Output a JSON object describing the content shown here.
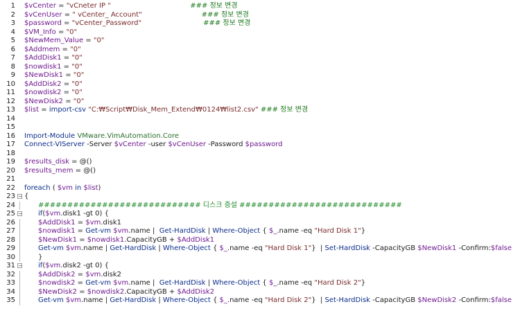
{
  "lines": [
    {
      "n": "1",
      "fold": "",
      "guide": false,
      "indent": 0,
      "tokens": [
        {
          "t": "v",
          "x": "$vCenter"
        },
        {
          "t": "p",
          "x": " = "
        },
        {
          "t": "s",
          "x": "\"vCneter IP \""
        },
        {
          "t": "p",
          "x": "                                    "
        },
        {
          "t": "cm",
          "x": "### 정보 변경"
        }
      ]
    },
    {
      "n": "2",
      "fold": "",
      "guide": false,
      "indent": 0,
      "tokens": [
        {
          "t": "v",
          "x": "$vCenUser"
        },
        {
          "t": "p",
          "x": " = "
        },
        {
          "t": "s",
          "x": "\" vCenter_ Account\""
        },
        {
          "t": "p",
          "x": "                           "
        },
        {
          "t": "cm",
          "x": "### 정보 변경"
        }
      ]
    },
    {
      "n": "3",
      "fold": "",
      "guide": false,
      "indent": 0,
      "tokens": [
        {
          "t": "v",
          "x": "$password"
        },
        {
          "t": "p",
          "x": " = "
        },
        {
          "t": "s",
          "x": "\"vCenter_Password\""
        },
        {
          "t": "p",
          "x": "                            "
        },
        {
          "t": "cm",
          "x": "### 정보 변경"
        }
      ]
    },
    {
      "n": "4",
      "fold": "",
      "guide": false,
      "indent": 0,
      "tokens": [
        {
          "t": "v",
          "x": "$VM_Info"
        },
        {
          "t": "p",
          "x": " = "
        },
        {
          "t": "s",
          "x": "\"0\""
        }
      ]
    },
    {
      "n": "5",
      "fold": "",
      "guide": false,
      "indent": 0,
      "tokens": [
        {
          "t": "v",
          "x": "$NewMem_Value"
        },
        {
          "t": "p",
          "x": " = "
        },
        {
          "t": "s",
          "x": "\"0\""
        }
      ]
    },
    {
      "n": "6",
      "fold": "",
      "guide": false,
      "indent": 0,
      "tokens": [
        {
          "t": "v",
          "x": "$Addmem"
        },
        {
          "t": "p",
          "x": " = "
        },
        {
          "t": "s",
          "x": "\"0\""
        }
      ]
    },
    {
      "n": "7",
      "fold": "",
      "guide": false,
      "indent": 0,
      "tokens": [
        {
          "t": "v",
          "x": "$AddDisk1"
        },
        {
          "t": "p",
          "x": " = "
        },
        {
          "t": "s",
          "x": "\"0\""
        }
      ]
    },
    {
      "n": "8",
      "fold": "",
      "guide": false,
      "indent": 0,
      "tokens": [
        {
          "t": "v",
          "x": "$nowdisk1"
        },
        {
          "t": "p",
          "x": " = "
        },
        {
          "t": "s",
          "x": "\"0\""
        }
      ]
    },
    {
      "n": "9",
      "fold": "",
      "guide": false,
      "indent": 0,
      "tokens": [
        {
          "t": "v",
          "x": "$NewDisk1"
        },
        {
          "t": "p",
          "x": " = "
        },
        {
          "t": "s",
          "x": "\"0\""
        }
      ]
    },
    {
      "n": "10",
      "fold": "",
      "guide": false,
      "indent": 0,
      "tokens": [
        {
          "t": "v",
          "x": "$AddDisk2"
        },
        {
          "t": "p",
          "x": " = "
        },
        {
          "t": "s",
          "x": "\"0\""
        }
      ]
    },
    {
      "n": "11",
      "fold": "",
      "guide": false,
      "indent": 0,
      "tokens": [
        {
          "t": "v",
          "x": "$nowdisk2"
        },
        {
          "t": "p",
          "x": " = "
        },
        {
          "t": "s",
          "x": "\"0\""
        }
      ]
    },
    {
      "n": "12",
      "fold": "",
      "guide": false,
      "indent": 0,
      "tokens": [
        {
          "t": "v",
          "x": "$NewDisk2"
        },
        {
          "t": "p",
          "x": " = "
        },
        {
          "t": "s",
          "x": "\"0\""
        }
      ]
    },
    {
      "n": "13",
      "fold": "",
      "guide": false,
      "indent": 0,
      "tokens": [
        {
          "t": "v",
          "x": "$list"
        },
        {
          "t": "p",
          "x": " = "
        },
        {
          "t": "k",
          "x": "import-csv"
        },
        {
          "t": "p",
          "x": " "
        },
        {
          "t": "s",
          "x": "\"C:₩Script₩Disk_Mem_Extend₩0124₩list2.csv\""
        },
        {
          "t": "p",
          "x": " "
        },
        {
          "t": "cm",
          "x": "### 정보 변경"
        }
      ]
    },
    {
      "n": "14",
      "fold": "",
      "guide": false,
      "indent": 0,
      "tokens": []
    },
    {
      "n": "15",
      "fold": "",
      "guide": false,
      "indent": 0,
      "tokens": []
    },
    {
      "n": "16",
      "fold": "",
      "guide": false,
      "indent": 0,
      "tokens": [
        {
          "t": "k",
          "x": "Import-Module"
        },
        {
          "t": "p",
          "x": " "
        },
        {
          "t": "c",
          "x": "VMware.VimAutomation.Core"
        }
      ]
    },
    {
      "n": "17",
      "fold": "",
      "guide": false,
      "indent": 0,
      "tokens": [
        {
          "t": "k",
          "x": "Connect-VIServer"
        },
        {
          "t": "p",
          "x": " -Server "
        },
        {
          "t": "v",
          "x": "$vCenter"
        },
        {
          "t": "p",
          "x": " -user "
        },
        {
          "t": "v",
          "x": "$vCenUser"
        },
        {
          "t": "p",
          "x": " -Password "
        },
        {
          "t": "v",
          "x": "$password"
        }
      ]
    },
    {
      "n": "18",
      "fold": "",
      "guide": false,
      "indent": 0,
      "tokens": []
    },
    {
      "n": "19",
      "fold": "",
      "guide": false,
      "indent": 0,
      "tokens": [
        {
          "t": "v",
          "x": "$results_disk"
        },
        {
          "t": "p",
          "x": " = @()"
        }
      ]
    },
    {
      "n": "20",
      "fold": "",
      "guide": false,
      "indent": 0,
      "tokens": [
        {
          "t": "v",
          "x": "$results_mem"
        },
        {
          "t": "p",
          "x": " = @()"
        }
      ]
    },
    {
      "n": "21",
      "fold": "",
      "guide": false,
      "indent": 0,
      "tokens": []
    },
    {
      "n": "22",
      "fold": "",
      "guide": false,
      "indent": 0,
      "tokens": [
        {
          "t": "k",
          "x": "foreach"
        },
        {
          "t": "p",
          "x": " ( "
        },
        {
          "t": "v",
          "x": "$vm"
        },
        {
          "t": "p",
          "x": " "
        },
        {
          "t": "k",
          "x": "in"
        },
        {
          "t": "p",
          "x": " "
        },
        {
          "t": "v",
          "x": "$list"
        },
        {
          "t": "p",
          "x": ")"
        }
      ]
    },
    {
      "n": "23",
      "fold": "−",
      "guide": false,
      "indent": 0,
      "tokens": [
        {
          "t": "p",
          "x": "{"
        }
      ]
    },
    {
      "n": "24",
      "fold": "",
      "guide": true,
      "indent": 1,
      "tokens": [
        {
          "t": "cmt",
          "x": "############################ 디스크 증설 ############################"
        }
      ]
    },
    {
      "n": "25",
      "fold": "−",
      "guide": false,
      "indent": 1,
      "tokens": [
        {
          "t": "k",
          "x": "if"
        },
        {
          "t": "p",
          "x": "("
        },
        {
          "t": "v",
          "x": "$vm"
        },
        {
          "t": "p",
          "x": ".disk1 -gt 0) {"
        }
      ]
    },
    {
      "n": "26",
      "fold": "",
      "guide": true,
      "indent": 1,
      "tokens": [
        {
          "t": "v",
          "x": "$AddDisk1"
        },
        {
          "t": "p",
          "x": " = "
        },
        {
          "t": "v",
          "x": "$vm"
        },
        {
          "t": "p",
          "x": ".disk1"
        }
      ]
    },
    {
      "n": "27",
      "fold": "",
      "guide": true,
      "indent": 1,
      "tokens": [
        {
          "t": "v",
          "x": "$nowdisk1"
        },
        {
          "t": "p",
          "x": " = "
        },
        {
          "t": "k",
          "x": "Get-vm"
        },
        {
          "t": "p",
          "x": " "
        },
        {
          "t": "v",
          "x": "$vm"
        },
        {
          "t": "p",
          "x": ".name |  "
        },
        {
          "t": "k",
          "x": "Get-HardDisk"
        },
        {
          "t": "p",
          "x": " | "
        },
        {
          "t": "k",
          "x": "Where-Object"
        },
        {
          "t": "p",
          "x": " { "
        },
        {
          "t": "v",
          "x": "$_"
        },
        {
          "t": "p",
          "x": ".name -eq "
        },
        {
          "t": "s",
          "x": "\"Hard Disk 1\""
        },
        {
          "t": "p",
          "x": "}"
        }
      ]
    },
    {
      "n": "28",
      "fold": "",
      "guide": true,
      "indent": 1,
      "tokens": [
        {
          "t": "v",
          "x": "$NewDisk1"
        },
        {
          "t": "p",
          "x": " = "
        },
        {
          "t": "v",
          "x": "$nowdisk1"
        },
        {
          "t": "p",
          "x": ".CapacityGB + "
        },
        {
          "t": "v",
          "x": "$AddDisk1"
        }
      ]
    },
    {
      "n": "29",
      "fold": "",
      "guide": true,
      "indent": 1,
      "tokens": [
        {
          "t": "k",
          "x": "Get-vm"
        },
        {
          "t": "p",
          "x": " "
        },
        {
          "t": "v",
          "x": "$vm"
        },
        {
          "t": "p",
          "x": ".name | "
        },
        {
          "t": "k",
          "x": "Get-HardDisk"
        },
        {
          "t": "p",
          "x": " | "
        },
        {
          "t": "k",
          "x": "Where-Object"
        },
        {
          "t": "p",
          "x": " { "
        },
        {
          "t": "v",
          "x": "$_"
        },
        {
          "t": "p",
          "x": ".name -eq "
        },
        {
          "t": "s",
          "x": "\"Hard Disk 1\""
        },
        {
          "t": "p",
          "x": "}  | "
        },
        {
          "t": "k",
          "x": "Set-HardDisk"
        },
        {
          "t": "p",
          "x": " -CapacityGB "
        },
        {
          "t": "v",
          "x": "$NewDisk1"
        },
        {
          "t": "p",
          "x": " -Confirm:"
        },
        {
          "t": "v",
          "x": "$false"
        }
      ]
    },
    {
      "n": "30",
      "fold": "",
      "guide": true,
      "indent": 1,
      "tokens": [
        {
          "t": "p",
          "x": "}"
        }
      ]
    },
    {
      "n": "31",
      "fold": "−",
      "guide": false,
      "indent": 1,
      "tokens": [
        {
          "t": "k",
          "x": "if"
        },
        {
          "t": "p",
          "x": "("
        },
        {
          "t": "v",
          "x": "$vm"
        },
        {
          "t": "p",
          "x": ".disk2 -gt 0) {"
        }
      ]
    },
    {
      "n": "32",
      "fold": "",
      "guide": true,
      "indent": 1,
      "tokens": [
        {
          "t": "v",
          "x": "$AddDisk2"
        },
        {
          "t": "p",
          "x": " = "
        },
        {
          "t": "v",
          "x": "$vm"
        },
        {
          "t": "p",
          "x": ".disk2"
        }
      ]
    },
    {
      "n": "33",
      "fold": "",
      "guide": true,
      "indent": 1,
      "tokens": [
        {
          "t": "v",
          "x": "$nowdisk2"
        },
        {
          "t": "p",
          "x": " = "
        },
        {
          "t": "k",
          "x": "Get-vm"
        },
        {
          "t": "p",
          "x": " "
        },
        {
          "t": "v",
          "x": "$vm"
        },
        {
          "t": "p",
          "x": ".name |  "
        },
        {
          "t": "k",
          "x": "Get-HardDisk"
        },
        {
          "t": "p",
          "x": " | "
        },
        {
          "t": "k",
          "x": "Where-Object"
        },
        {
          "t": "p",
          "x": " { "
        },
        {
          "t": "v",
          "x": "$_"
        },
        {
          "t": "p",
          "x": ".name -eq "
        },
        {
          "t": "s",
          "x": "\"Hard Disk 2\""
        },
        {
          "t": "p",
          "x": "}"
        }
      ]
    },
    {
      "n": "34",
      "fold": "",
      "guide": true,
      "indent": 1,
      "tokens": [
        {
          "t": "v",
          "x": "$NewDisk2"
        },
        {
          "t": "p",
          "x": " = "
        },
        {
          "t": "v",
          "x": "$nowdisk2"
        },
        {
          "t": "p",
          "x": ".CapacityGB + "
        },
        {
          "t": "v",
          "x": "$AddDisk2"
        }
      ]
    },
    {
      "n": "35",
      "fold": "",
      "guide": true,
      "indent": 1,
      "tokens": [
        {
          "t": "k",
          "x": "Get-vm"
        },
        {
          "t": "p",
          "x": " "
        },
        {
          "t": "v",
          "x": "$vm"
        },
        {
          "t": "p",
          "x": ".name | "
        },
        {
          "t": "k",
          "x": "Get-HardDisk"
        },
        {
          "t": "p",
          "x": " | "
        },
        {
          "t": "k",
          "x": "Where-Object"
        },
        {
          "t": "p",
          "x": " { "
        },
        {
          "t": "v",
          "x": "$_"
        },
        {
          "t": "p",
          "x": ".name -eq "
        },
        {
          "t": "s",
          "x": "\"Hard Disk 2\""
        },
        {
          "t": "p",
          "x": "}  | "
        },
        {
          "t": "k",
          "x": "Set-HardDisk"
        },
        {
          "t": "p",
          "x": " -CapacityGB "
        },
        {
          "t": "v",
          "x": "$NewDisk2"
        },
        {
          "t": "p",
          "x": " -Confirm:"
        },
        {
          "t": "v",
          "x": "$false"
        }
      ]
    }
  ]
}
